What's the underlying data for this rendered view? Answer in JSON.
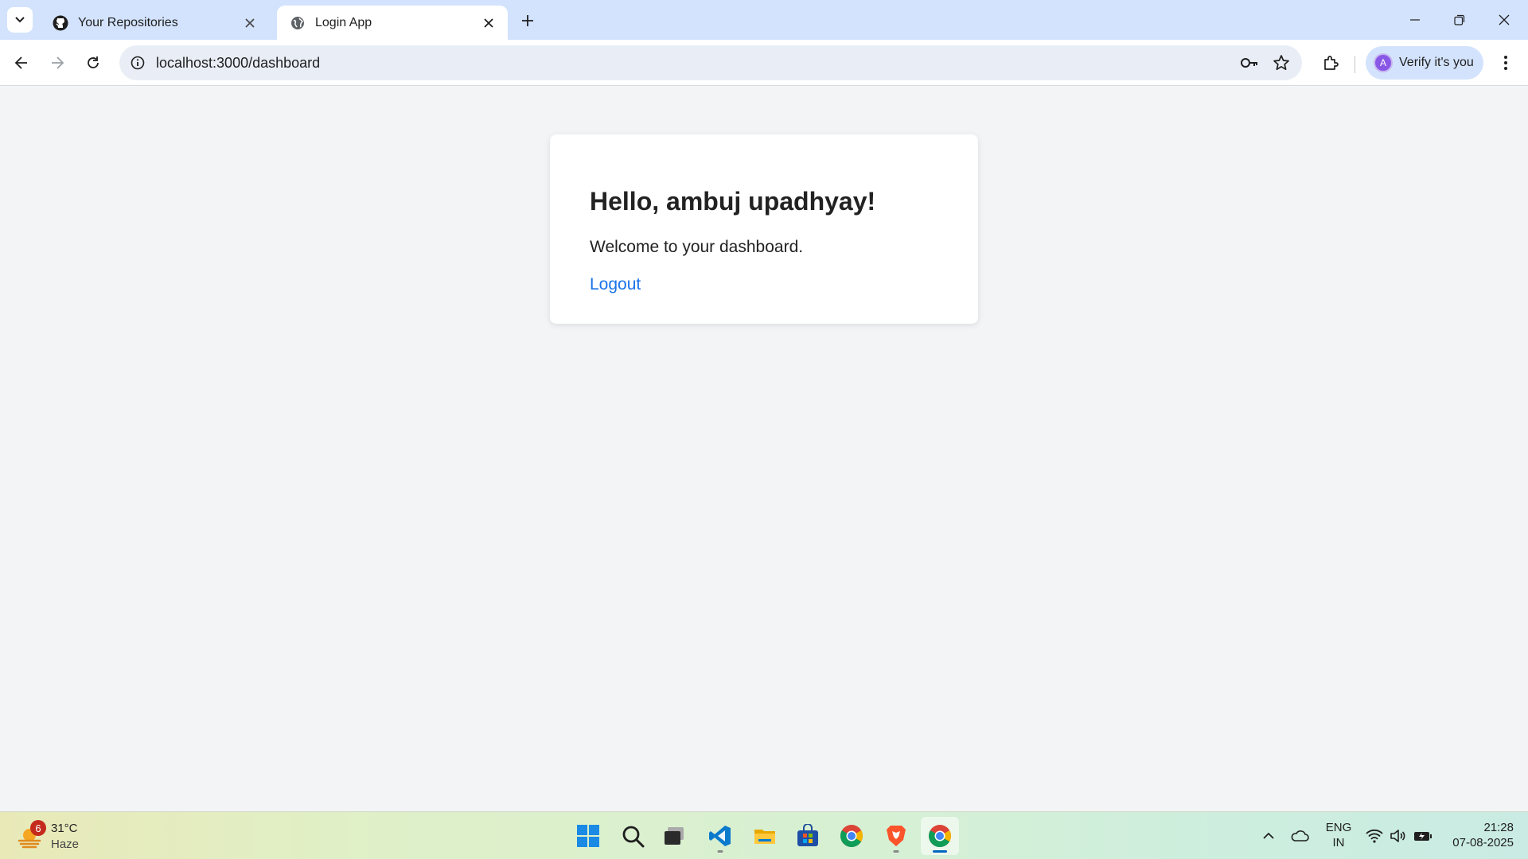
{
  "browser": {
    "tabs": [
      {
        "title": "Your Repositories",
        "active": false
      },
      {
        "title": "Login App",
        "active": true
      }
    ],
    "url": "localhost:3000/dashboard",
    "profile_label": "Verify it's you",
    "profile_initial": "A"
  },
  "page": {
    "greeting": "Hello, ambuj upadhyay!",
    "welcome": "Welcome to your dashboard.",
    "logout_label": "Logout",
    "link_color": "#1a73e8"
  },
  "taskbar": {
    "weather": {
      "temp": "31°C",
      "condition": "Haze",
      "badge": "6"
    },
    "apps": [
      "start-icon",
      "search-icon",
      "task-view-icon",
      "vscode-icon",
      "file-explorer-icon",
      "store-icon",
      "chrome-icon",
      "brave-icon",
      "chrome-icon"
    ],
    "lang_line1": "ENG",
    "lang_line2": "IN",
    "time": "21:28",
    "date": "07-08-2025"
  }
}
